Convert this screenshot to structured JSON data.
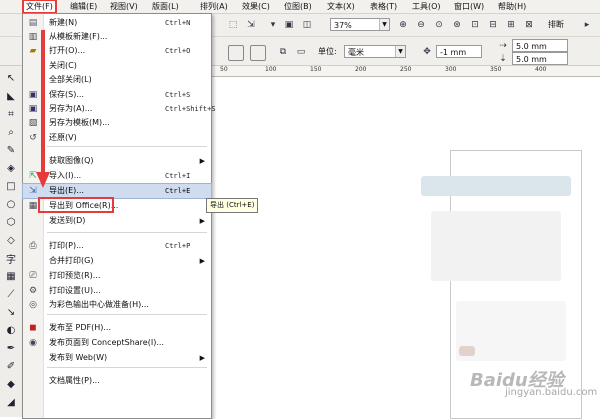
{
  "menubar": {
    "items": [
      {
        "label": "文件(F)",
        "active": true
      },
      {
        "label": "编辑(E)"
      },
      {
        "label": "视图(V)"
      },
      {
        "label": "版面(L)"
      },
      {
        "label": "排列(A)"
      },
      {
        "label": "效果(C)"
      },
      {
        "label": "位图(B)"
      },
      {
        "label": "文本(X)"
      },
      {
        "label": "表格(T)"
      },
      {
        "label": "工具(O)"
      },
      {
        "label": "窗口(W)"
      },
      {
        "label": "帮助(H)"
      }
    ]
  },
  "toolbar1": {
    "zoom_value": "37%",
    "arrange_label": "排断"
  },
  "toolbar2": {
    "units_label": "单位:",
    "units_value": "毫米",
    "nudge_value": "-1 mm",
    "dup_x": "5.0 mm",
    "dup_y": "5.0 mm"
  },
  "ruler": {
    "ticks": [
      "50",
      "100",
      "150",
      "200",
      "250",
      "300",
      "350",
      "400"
    ]
  },
  "file_menu": {
    "items": [
      {
        "label": "新建(N)",
        "shortcut": "Ctrl+N",
        "icon": "new-document-icon"
      },
      {
        "label": "从模板新建(F)...",
        "shortcut": "",
        "icon": "new-from-template-icon"
      },
      {
        "label": "打开(O)...",
        "shortcut": "Ctrl+O",
        "icon": "open-folder-icon"
      },
      {
        "label": "关闭(C)",
        "shortcut": "",
        "icon": ""
      },
      {
        "label": "全部关闭(L)",
        "shortcut": "",
        "icon": ""
      },
      {
        "label": "保存(S)...",
        "shortcut": "Ctrl+S",
        "icon": "save-icon"
      },
      {
        "label": "另存为(A)...",
        "shortcut": "Ctrl+Shift+S",
        "icon": "save-as-icon"
      },
      {
        "label": "另存为模板(M)...",
        "shortcut": "",
        "icon": "save-template-icon"
      },
      {
        "label": "还原(V)",
        "shortcut": "",
        "icon": "revert-icon"
      },
      {
        "label": "获取图像(Q)",
        "shortcut": "",
        "icon": "",
        "submenu": true
      },
      {
        "label": "导入(I)...",
        "shortcut": "Ctrl+I",
        "icon": "import-icon"
      },
      {
        "label": "导出(E)...",
        "shortcut": "Ctrl+E",
        "icon": "export-icon",
        "highlighted": true
      },
      {
        "label": "导出到 Office(R)...",
        "shortcut": "",
        "icon": "export-office-icon"
      },
      {
        "label": "发送到(D)",
        "shortcut": "",
        "icon": "",
        "submenu": true
      },
      {
        "label": "打印(P)...",
        "shortcut": "Ctrl+P",
        "icon": "print-icon"
      },
      {
        "label": "合并打印(G)",
        "shortcut": "",
        "icon": "",
        "submenu": true
      },
      {
        "label": "打印预览(R)...",
        "shortcut": "",
        "icon": "print-preview-icon"
      },
      {
        "label": "打印设置(U)...",
        "shortcut": "",
        "icon": "print-setup-icon"
      },
      {
        "label": "为彩色输出中心做准备(H)...",
        "shortcut": "",
        "icon": "prepare-output-icon"
      },
      {
        "label": "发布至 PDF(H)...",
        "shortcut": "",
        "icon": "pdf-icon"
      },
      {
        "label": "发布页面到 ConceptShare(I)...",
        "shortcut": "",
        "icon": "conceptshare-icon"
      },
      {
        "label": "发布到 Web(W)",
        "shortcut": "",
        "icon": "",
        "submenu": true
      },
      {
        "label": "文档属性(P)...",
        "shortcut": "",
        "icon": ""
      }
    ]
  },
  "tooltip": {
    "text": "导出 (Ctrl+E)"
  },
  "watermark": {
    "text": "Baidu经验",
    "sub": "jingyan.baidu.com"
  },
  "colors": {
    "accent_red": "#e53b3b",
    "menu_highlight": "#cfdcef"
  }
}
